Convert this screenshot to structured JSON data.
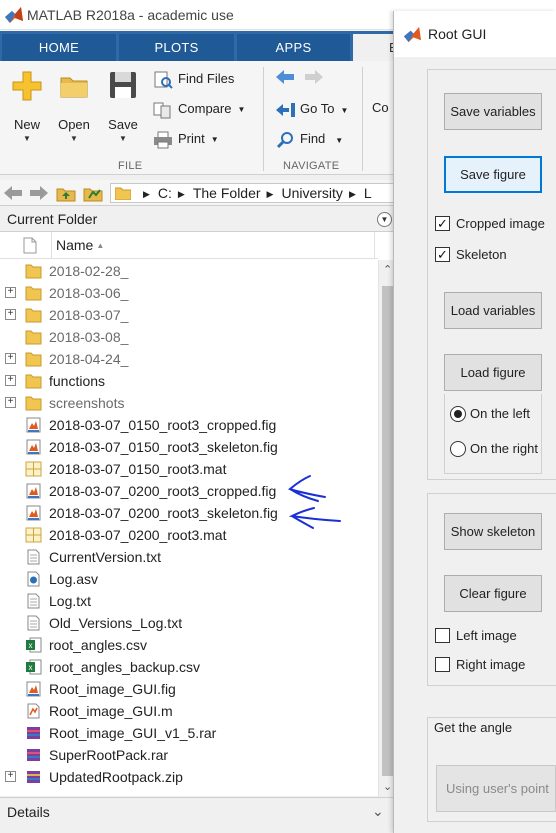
{
  "matlab_window": {
    "title": "MATLAB R2018a - academic use",
    "tabs": [
      {
        "label": "HOME",
        "active": true
      },
      {
        "label": "PLOTS",
        "active": false
      },
      {
        "label": "APPS",
        "active": false
      },
      {
        "label": "E",
        "active": false
      }
    ],
    "ribbon": {
      "file_group": {
        "label": "FILE",
        "new_label": "New",
        "open_label": "Open",
        "save_label": "Save",
        "find_files_label": "Find Files",
        "compare_label": "Compare",
        "print_label": "Print"
      },
      "navigate_group": {
        "label": "NAVIGATE",
        "go_to_label": "Go To",
        "find_label": "Find"
      },
      "cut_off_label": "Co"
    },
    "address_bar": {
      "crumbs": [
        "C:",
        "The Folder",
        "University",
        "L"
      ]
    },
    "current_folder": {
      "title": "Current Folder",
      "column_name": "Name",
      "sort": "ascending",
      "files": [
        {
          "name": "2018-02-28_",
          "type": "folder",
          "expandable": false,
          "dim": true
        },
        {
          "name": "2018-03-06_",
          "type": "folder",
          "expandable": true,
          "dim": true
        },
        {
          "name": "2018-03-07_",
          "type": "folder",
          "expandable": true,
          "dim": true
        },
        {
          "name": "2018-03-08_",
          "type": "folder",
          "expandable": false,
          "dim": true
        },
        {
          "name": "2018-04-24_",
          "type": "folder",
          "expandable": true,
          "dim": true
        },
        {
          "name": "functions",
          "type": "folder",
          "expandable": true,
          "dim": false
        },
        {
          "name": "screenshots",
          "type": "folder",
          "expandable": true,
          "dim": true
        },
        {
          "name": "2018-03-07_0150_root3_cropped.fig",
          "type": "fig",
          "expandable": false,
          "dim": false
        },
        {
          "name": "2018-03-07_0150_root3_skeleton.fig",
          "type": "fig",
          "expandable": false,
          "dim": false
        },
        {
          "name": "2018-03-07_0150_root3.mat",
          "type": "mat",
          "expandable": false,
          "dim": false
        },
        {
          "name": "2018-03-07_0200_root3_cropped.fig",
          "type": "fig",
          "expandable": false,
          "dim": false
        },
        {
          "name": "2018-03-07_0200_root3_skeleton.fig",
          "type": "fig",
          "expandable": false,
          "dim": false
        },
        {
          "name": "2018-03-07_0200_root3.mat",
          "type": "mat",
          "expandable": false,
          "dim": false
        },
        {
          "name": "CurrentVersion.txt",
          "type": "txt",
          "expandable": false,
          "dim": false
        },
        {
          "name": "Log.asv",
          "type": "asv",
          "expandable": false,
          "dim": false
        },
        {
          "name": "Log.txt",
          "type": "txt",
          "expandable": false,
          "dim": false
        },
        {
          "name": "Old_Versions_Log.txt",
          "type": "txt",
          "expandable": false,
          "dim": false
        },
        {
          "name": "root_angles.csv",
          "type": "csv",
          "expandable": false,
          "dim": false
        },
        {
          "name": "root_angles_backup.csv",
          "type": "csv",
          "expandable": false,
          "dim": false
        },
        {
          "name": "Root_image_GUI.fig",
          "type": "fig",
          "expandable": false,
          "dim": false
        },
        {
          "name": "Root_image_GUI.m",
          "type": "m",
          "expandable": false,
          "dim": false
        },
        {
          "name": "Root_image_GUI_v1_5.rar",
          "type": "rar",
          "expandable": false,
          "dim": false
        },
        {
          "name": "SuperRootPack.rar",
          "type": "rar",
          "expandable": false,
          "dim": false
        },
        {
          "name": "UpdatedRootpack.zip",
          "type": "zip",
          "expandable": true,
          "dim": false
        }
      ]
    },
    "details_label": "Details"
  },
  "root_gui": {
    "title": "Root GUI",
    "save_variables_label": "Save variables",
    "save_figure_label": "Save figure",
    "cropped_image_label": "Cropped image",
    "cropped_image_checked": true,
    "skeleton_label": "Skeleton",
    "skeleton_checked": true,
    "load_variables_label": "Load variables",
    "load_figure_label": "Load figure",
    "on_the_left_label": "On the left",
    "on_the_right_label": "On the right",
    "selected_side": "left",
    "show_skeleton_label": "Show skeleton",
    "clear_figure_label": "Clear figure",
    "left_image_label": "Left image",
    "left_image_checked": false,
    "right_image_label": "Right image",
    "right_image_checked": false,
    "get_the_angle_label": "Get the angle",
    "using_user_point_label": "Using user's point"
  },
  "colors": {
    "tabstrip": "#2e6aa7",
    "tab": "#1f5a97",
    "focus_border": "#0078d7",
    "annotation_ink": "#1a2fd6"
  },
  "icons": {
    "app_logo": "matlab-membrane-icon",
    "folder": "folder-icon",
    "fig": "figure-file-icon",
    "mat": "mat-file-icon",
    "txt": "text-file-icon",
    "csv": "excel-csv-icon",
    "rar": "archive-icon"
  }
}
